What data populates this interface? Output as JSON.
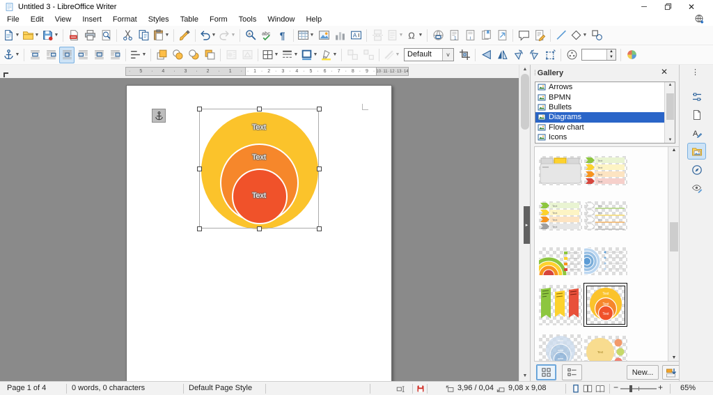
{
  "window": {
    "title": "Untitled 3 - LibreOffice Writer"
  },
  "menubar": {
    "items": [
      "File",
      "Edit",
      "View",
      "Insert",
      "Format",
      "Styles",
      "Table",
      "Form",
      "Tools",
      "Window",
      "Help"
    ]
  },
  "toolbar_main": {
    "items": [
      {
        "name": "new-document",
        "dropdown": true
      },
      {
        "name": "open-file",
        "dropdown": true
      },
      {
        "name": "save",
        "dropdown": true
      },
      {
        "type": "sep"
      },
      {
        "name": "export-pdf"
      },
      {
        "name": "print"
      },
      {
        "name": "print-preview"
      },
      {
        "type": "sep"
      },
      {
        "name": "cut"
      },
      {
        "name": "copy"
      },
      {
        "name": "paste",
        "dropdown": true
      },
      {
        "type": "sep"
      },
      {
        "name": "clone-formatting"
      },
      {
        "type": "sep"
      },
      {
        "name": "undo",
        "dropdown": true
      },
      {
        "name": "redo",
        "dropdown": true,
        "disabled": true
      },
      {
        "type": "sep"
      },
      {
        "name": "find-replace"
      },
      {
        "name": "spelling"
      },
      {
        "name": "formatting-marks"
      },
      {
        "type": "sep"
      },
      {
        "name": "insert-table",
        "dropdown": true
      },
      {
        "name": "insert-image"
      },
      {
        "name": "insert-chart"
      },
      {
        "name": "insert-textbox"
      },
      {
        "type": "sep"
      },
      {
        "name": "page-break",
        "disabled": true
      },
      {
        "name": "insert-field",
        "dropdown": true,
        "disabled": true
      },
      {
        "name": "special-character",
        "dropdown": true
      },
      {
        "type": "sep"
      },
      {
        "name": "insert-hyperlink"
      },
      {
        "name": "insert-footnote"
      },
      {
        "name": "insert-endnote"
      },
      {
        "name": "insert-bookmark"
      },
      {
        "name": "cross-reference"
      },
      {
        "type": "sep"
      },
      {
        "name": "insert-comment"
      },
      {
        "name": "track-changes"
      },
      {
        "type": "sep"
      },
      {
        "name": "insert-line"
      },
      {
        "name": "basic-shapes",
        "dropdown": true
      },
      {
        "name": "draw-functions"
      }
    ]
  },
  "toolbar_frame": {
    "items": [
      {
        "name": "anchor",
        "dropdown": true
      },
      {
        "type": "sep"
      },
      {
        "name": "wrap-off"
      },
      {
        "name": "wrap-left"
      },
      {
        "name": "wrap-parallel",
        "active": true
      },
      {
        "name": "wrap-right"
      },
      {
        "name": "wrap-through"
      },
      {
        "name": "wrap-optimal"
      },
      {
        "type": "sep"
      },
      {
        "name": "align-objects",
        "dropdown": true
      },
      {
        "type": "sep"
      },
      {
        "name": "bring-to-front"
      },
      {
        "name": "bring-forward"
      },
      {
        "name": "send-backward"
      },
      {
        "name": "send-to-back"
      },
      {
        "type": "sep"
      },
      {
        "name": "contour",
        "disabled": true
      },
      {
        "name": "edit-contour",
        "disabled": true
      },
      {
        "type": "sep"
      },
      {
        "name": "borders",
        "dropdown": true
      },
      {
        "name": "border-style",
        "dropdown": true
      },
      {
        "name": "border-color",
        "dropdown": true
      },
      {
        "name": "highlight-color",
        "dropdown": true
      },
      {
        "type": "sep"
      },
      {
        "name": "group",
        "disabled": true
      },
      {
        "name": "ungroup",
        "disabled": true
      },
      {
        "type": "sep"
      },
      {
        "name": "line-style",
        "dropdown": true,
        "disabled": true
      },
      {
        "type": "combo"
      },
      {
        "name": "crop-image"
      },
      {
        "type": "sep"
      },
      {
        "name": "flip-vertically"
      },
      {
        "name": "flip-horizontally"
      },
      {
        "name": "rotate-left"
      },
      {
        "name": "rotate-right"
      },
      {
        "name": "transformations"
      },
      {
        "type": "sep"
      },
      {
        "name": "image-filter"
      },
      {
        "type": "spinner"
      },
      {
        "type": "sep"
      },
      {
        "name": "color-mode"
      }
    ],
    "style_combo": {
      "value": "Default"
    },
    "spinner": {
      "value": ""
    }
  },
  "ruler": {
    "left_margin": [
      "5",
      "4",
      "3",
      "2",
      "1"
    ],
    "content": [
      "1",
      "2",
      "3",
      "4",
      "5",
      "6",
      "7",
      "8",
      "9"
    ],
    "right_margin": [
      "10",
      "11",
      "12",
      "13",
      "14"
    ]
  },
  "document": {
    "diagram": {
      "labels": [
        "Text",
        "Text",
        "Text"
      ],
      "colors": {
        "outer": "#FBC32B",
        "middle": "#F6872B",
        "inner": "#F0522A"
      }
    }
  },
  "gallery": {
    "title": "Gallery",
    "categories": [
      {
        "label": "Arrows"
      },
      {
        "label": "BPMN"
      },
      {
        "label": "Bullets"
      },
      {
        "label": "Diagrams",
        "selected": true
      },
      {
        "label": "Flow chart"
      },
      {
        "label": "Icons"
      }
    ],
    "thumbnails": [
      {
        "name": "tabbed-panel"
      },
      {
        "name": "chevron-list-warm"
      },
      {
        "name": "chevron-list-muted"
      },
      {
        "name": "chevron-list-outline"
      },
      {
        "name": "stacked-rounds-warm"
      },
      {
        "name": "stacked-rounds-blue"
      },
      {
        "name": "banner-flags"
      },
      {
        "name": "nested-circles-warm",
        "selected": true
      },
      {
        "name": "nested-circles-blue"
      },
      {
        "name": "bubble-circles"
      }
    ],
    "new_button": "New...",
    "view_modes": [
      "icon-view",
      "detail-view"
    ]
  },
  "sidebar_tabs": [
    {
      "name": "properties"
    },
    {
      "name": "page"
    },
    {
      "name": "styles"
    },
    {
      "name": "gallery",
      "active": true
    },
    {
      "name": "navigator"
    },
    {
      "name": "accessibility-check"
    }
  ],
  "statusbar": {
    "page": "Page 1 of 4",
    "word_count": "0 words, 0 characters",
    "page_style": "Default Page Style",
    "position": "3,96 / 0,04",
    "object_size": "9,08 x 9,08",
    "zoom_level": "65%"
  },
  "colors": {
    "accent": "#2a65c8",
    "highlight_row": "#2a65c8"
  }
}
